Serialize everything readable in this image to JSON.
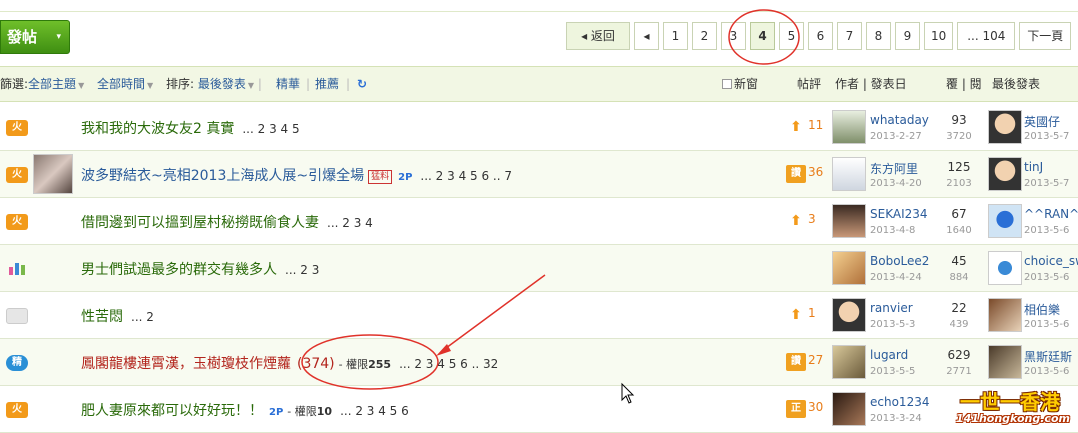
{
  "actions": {
    "post_label": "發帖",
    "post_caret": "▾"
  },
  "pager": {
    "back_label": "◂ 返回",
    "prev_label": "◂",
    "pages": [
      "1",
      "2",
      "3",
      "4",
      "5",
      "6",
      "7",
      "8",
      "9",
      "10"
    ],
    "current": "4",
    "last_label": "... 104",
    "next_label": "下一頁"
  },
  "filter": {
    "prefix": "篩選:",
    "subject": "全部主題",
    "time": "全部時間",
    "sort_prefix": "排序:",
    "sort": "最後發表",
    "digest": "精華",
    "recommend": "推薦",
    "refresh_icon": "refresh-icon",
    "new_window": "新窗",
    "replies_hdr": "帖評",
    "author_hdr": "作者 | 發表日",
    "reply_view_hdr": "覆 | 閱",
    "last_post_hdr": "最後發表"
  },
  "threads": [
    {
      "icon": "hot",
      "icon_text": "火",
      "title": "我和我的大波女友2 真實",
      "pages": "... 2 3 4 5",
      "reply_icon": "up-arrow",
      "replies": "11",
      "author": "whataday",
      "date": "2013-2-27",
      "rep": "93",
      "views": "3720",
      "last_user": "英國仔",
      "last_date": "2013-5-7"
    },
    {
      "icon": "hot",
      "icon_text": "火",
      "title": "波多野結衣~亮相2013上海成人展~引爆全場",
      "badge": "猛料",
      "tag": "2P",
      "pages": "... 2 3 4 5 6 .. 7",
      "reply_icon": "box",
      "reply_icon_text": "讚",
      "replies": "36",
      "author": "东方阿里",
      "date": "2013-4-20",
      "rep": "125",
      "views": "2103",
      "last_user": "tinJ",
      "last_date": "2013-5-7"
    },
    {
      "icon": "hot",
      "icon_text": "火",
      "title": "借問邊到可以搵到屋村秘撈既偷食人妻",
      "pages": "... 2 3 4",
      "reply_icon": "up-arrow",
      "replies": "3",
      "author": "SEKAI234",
      "date": "2013-4-8",
      "rep": "67",
      "views": "1640",
      "last_user": "^^RAN^",
      "last_date": "2013-5-6"
    },
    {
      "icon": "poll",
      "icon_text": "",
      "title": "男士們試過最多的群交有幾多人",
      "pages": "... 2 3",
      "reply_icon": "",
      "replies": "",
      "author": "BoboLee29",
      "date": "2013-4-24",
      "rep": "45",
      "views": "884",
      "last_user": "choice_sw",
      "last_date": "2013-5-6"
    },
    {
      "icon": "plain",
      "icon_text": "",
      "title": "性苦悶",
      "pages": "... 2",
      "reply_icon": "up-arrow",
      "replies": "1",
      "author": "ranvier",
      "date": "2013-5-3",
      "rep": "22",
      "views": "439",
      "last_user": "相伯樂",
      "last_date": "2013-5-6"
    },
    {
      "icon": "jing",
      "icon_text": "精",
      "title": "鳳閣龍樓連霄漢，玉樹瓊枝作煙蘿",
      "count": "(374)",
      "perm_label": "- 權限",
      "perm_value": "255",
      "pages": "... 2 3 4 5 6 .. 32",
      "reply_icon": "box",
      "reply_icon_text": "讚",
      "replies": "27",
      "author": "lugard",
      "date": "2013-5-5",
      "rep": "629",
      "views": "2771",
      "last_user": "黑斯廷斯",
      "last_date": "2013-5-6"
    },
    {
      "icon": "hot",
      "icon_text": "火",
      "title": "肥人妻原來都可以好好玩！！",
      "tag": "2P",
      "perm_label": "- 權限",
      "perm_value": "10",
      "pages": "... 2 3 4 5 6",
      "reply_icon": "box",
      "reply_icon_text": "正",
      "replies": "30",
      "author": "echo1234",
      "date": "2013-3-24",
      "rep": "",
      "views": "",
      "last_user": "",
      "last_date": ""
    }
  ],
  "watermark": {
    "main": "一世一香港",
    "sub": "141hongkong.com"
  },
  "colors": {
    "brand_green": "#4f9e1c",
    "annotation_red": "#e0322a",
    "link_blue": "#2a5b9a",
    "title_green": "#2a6a0a"
  }
}
